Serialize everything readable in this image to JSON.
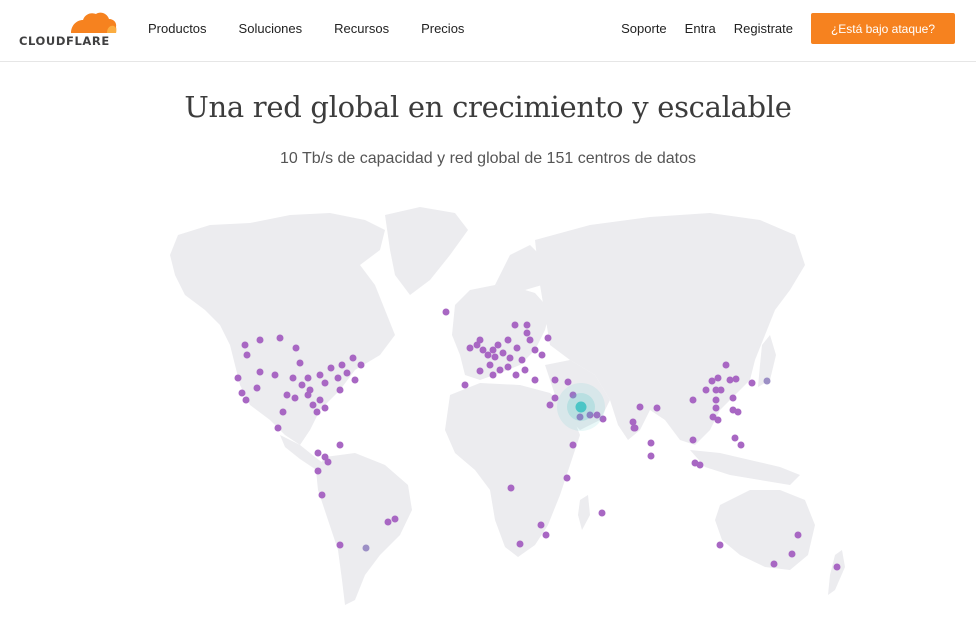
{
  "header": {
    "logo_text": "CLOUDFLARE",
    "nav_left": [
      "Productos",
      "Soluciones",
      "Recursos",
      "Precios"
    ],
    "nav_right": [
      "Soporte",
      "Entra",
      "Registrate"
    ],
    "cta_label": "¿Está bajo ataque?"
  },
  "hero": {
    "title": "Una red global en crecimiento y escalable",
    "subtitle": "10 Tb/s de capacidad y red global de 151 centros de datos"
  },
  "colors": {
    "brand_orange": "#f6821f",
    "datacenter_dot": "#a867c3",
    "highlight_dot": "#4bc5c6",
    "land": "#ececef"
  },
  "icons": {
    "logo": "cloudflare-cloud-icon",
    "highlight": "active-datacenter-pulse-icon"
  }
}
